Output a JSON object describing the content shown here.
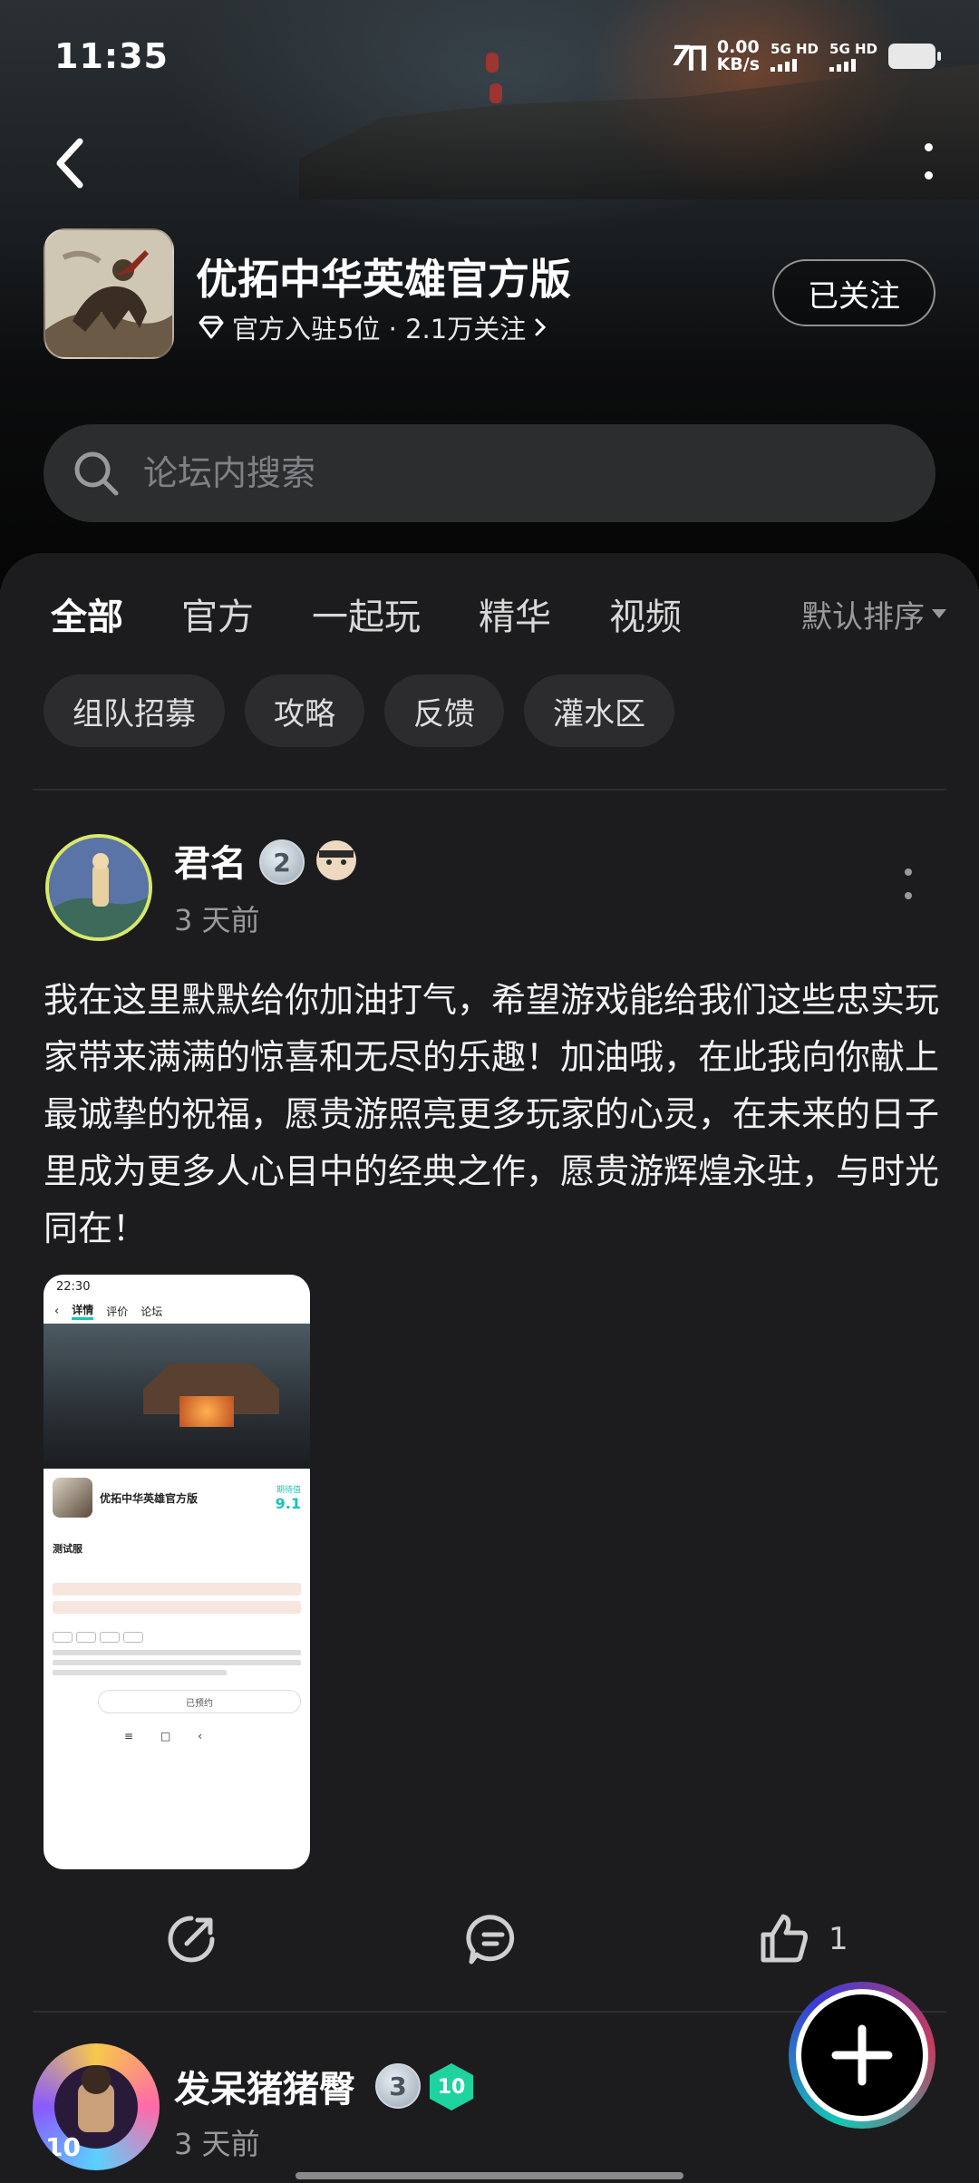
{
  "status_bar": {
    "time": "11:35",
    "speed_value": "0.00",
    "speed_unit": "KB/s",
    "sim1": "5G HD",
    "sim2": "5G HD"
  },
  "header": {
    "app_title": "优拓中华英雄官方版",
    "meta": "官方入驻5位 · 2.1万关注",
    "follow_label": "已关注"
  },
  "search": {
    "placeholder": "论坛内搜索"
  },
  "tabs": [
    {
      "label": "全部",
      "active": true
    },
    {
      "label": "官方"
    },
    {
      "label": "一起玩"
    },
    {
      "label": "精华"
    },
    {
      "label": "视频"
    }
  ],
  "sort_label": "默认排序",
  "chips": [
    "组队招募",
    "攻略",
    "反馈",
    "灌水区"
  ],
  "posts": [
    {
      "author": "君名",
      "level": "2",
      "time": "3 天前",
      "content": "我在这里默默给你加油打气，希望游戏能给我们这些忠实玩家带来满满的惊喜和无尽的乐趣！加油哦，在此我向你献上最诚挚的祝福，愿贵游照亮更多玩家的心灵，在未来的日子里成为更多人心目中的经典之作，愿贵游辉煌永驻，与时光同在！",
      "like_count": "1",
      "screenshot": {
        "time": "22:30",
        "tabs": [
          "详情",
          "评价",
          "论坛"
        ],
        "app_name": "优拓中华英雄官方版",
        "score_label": "期待值",
        "score": "9.1",
        "test_label": "测试服",
        "reserve_label": "已预约"
      }
    },
    {
      "author": "发呆猪猪臀",
      "level": "3",
      "badge": "10",
      "time": "3 天前"
    }
  ],
  "colors": {
    "accent": "#16c6b4",
    "background": "#1c1c1e"
  }
}
